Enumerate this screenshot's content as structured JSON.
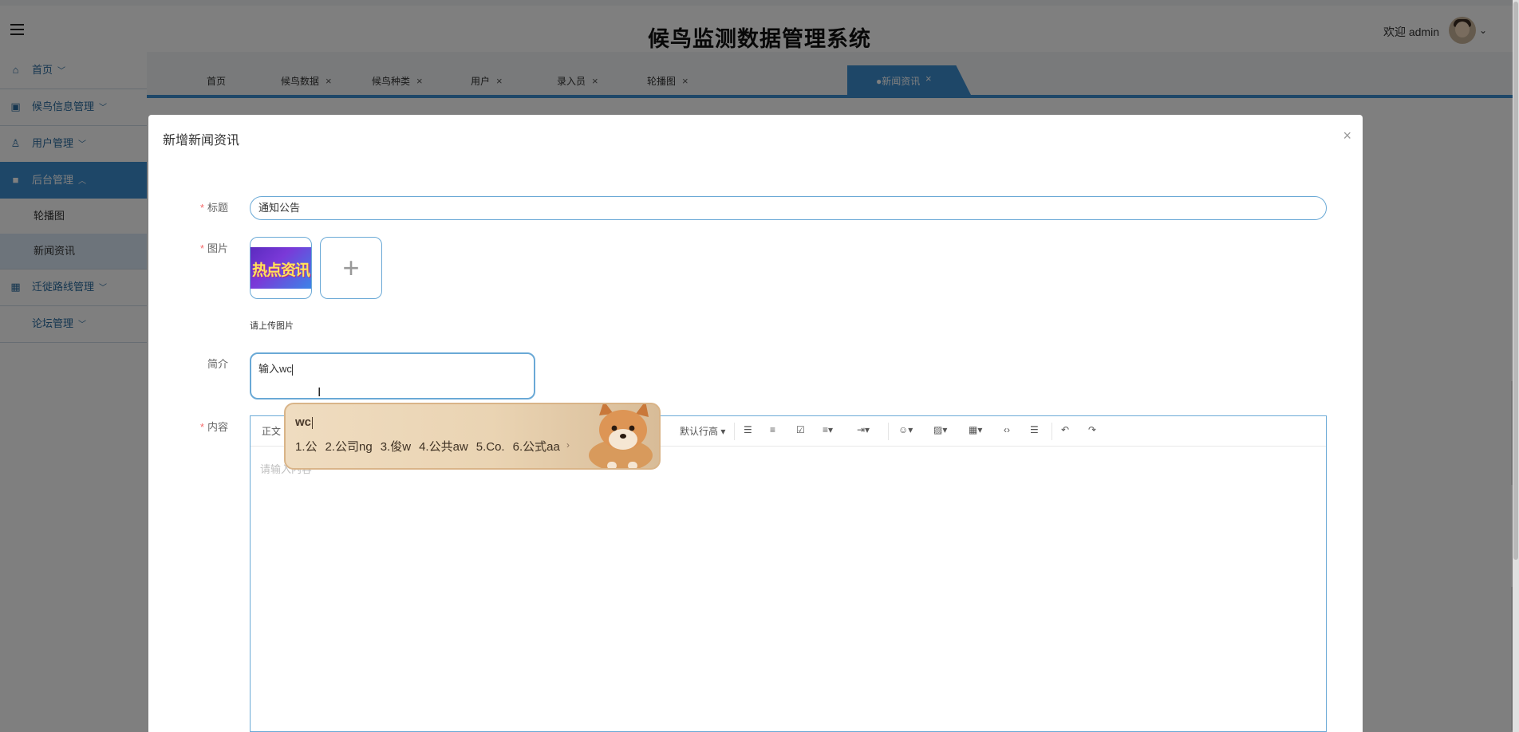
{
  "header": {
    "system_title": "候鸟监测数据管理系统",
    "welcome": "欢迎 admin"
  },
  "sidebar": {
    "items": [
      {
        "label": "首页",
        "icon": "home-icon"
      },
      {
        "label": "候鸟信息管理",
        "icon": "chip-icon"
      },
      {
        "label": "用户管理",
        "icon": "user-icon"
      },
      {
        "label": "后台管理",
        "icon": "folder-icon",
        "active": true
      },
      {
        "label": "迁徙路线管理",
        "icon": "grid-icon"
      },
      {
        "label": "论坛管理",
        "icon": ""
      }
    ],
    "subitems": [
      {
        "label": "轮播图"
      },
      {
        "label": "新闻资讯",
        "active": true
      }
    ]
  },
  "tabs": [
    {
      "label": "首页"
    },
    {
      "label": "候鸟数据"
    },
    {
      "label": "候鸟种类"
    },
    {
      "label": "用户"
    },
    {
      "label": "录入员"
    },
    {
      "label": "轮播图"
    },
    {
      "label": "●新闻资讯",
      "active": true
    }
  ],
  "tab_close": "×",
  "modal": {
    "title": "新增新闻资讯",
    "close": "×",
    "fields": {
      "title_label": "标题",
      "title_value": "通知公告",
      "image_label": "图片",
      "image_thumb_text": "热点资讯",
      "upload_plus": "+",
      "upload_hint": "请上传图片",
      "intro_label": "简介",
      "intro_value": "输入wc",
      "content_label": "内容",
      "required_mark": "*"
    },
    "editor": {
      "paragraph_select": "正文",
      "line_height_select": "默认行高",
      "placeholder": "请输入内容"
    }
  },
  "ime": {
    "composition": "wc",
    "candidates": [
      "1.公",
      "2.公司ng",
      "3.俊w",
      "4.公共aw",
      "5.Co.",
      "6.公式aa"
    ],
    "next_arrow": "›"
  },
  "colors": {
    "accent": "#3d8fd1",
    "sidebar_text": "#2b6ca0",
    "input_border": "#6aa9d6",
    "required": "#f56c6c"
  }
}
